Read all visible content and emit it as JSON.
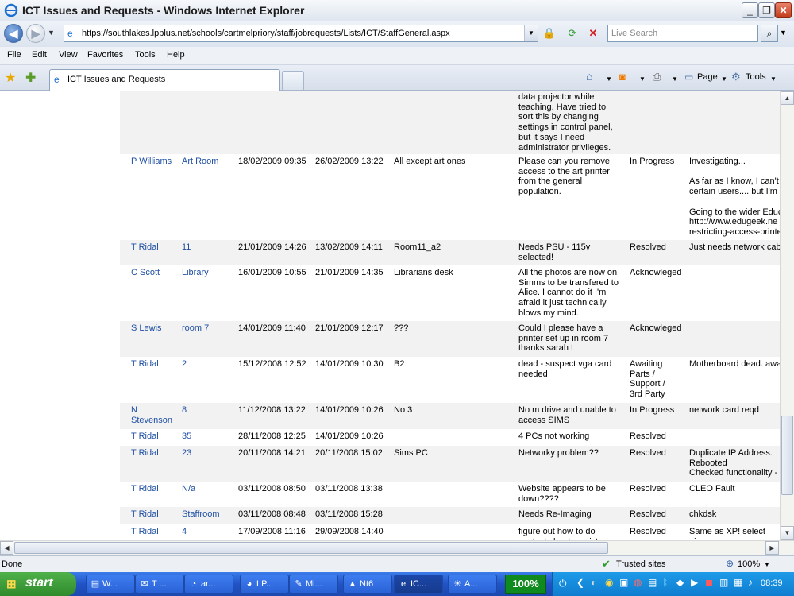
{
  "window": {
    "title": "ICT Issues and Requests - Windows Internet Explorer",
    "min": "_",
    "max": "❐",
    "close": "✕"
  },
  "address": {
    "url": "https://southlakes.lpplus.net/schools/cartmelpriory/staff/jobrequests/Lists/ICT/StaffGeneral.aspx",
    "search_placeholder": "Live Search"
  },
  "menu": [
    "File",
    "Edit",
    "View",
    "Favorites",
    "Tools",
    "Help"
  ],
  "tab": {
    "label": "ICT Issues and Requests"
  },
  "commands": {
    "page": "Page",
    "tools": "Tools"
  },
  "rows": [
    {
      "name": "",
      "room": "",
      "opened": "",
      "modified": "",
      "location": "",
      "description": "data projector while\nteaching. Have tried to\nsort this by changing\nsettings in control panel,\nbut it says I need\nadministrator privileges.",
      "status": "",
      "notes": ""
    },
    {
      "name": "P Williams",
      "room": "Art Room",
      "opened": "18/02/2009 09:35",
      "modified": "26/02/2009 13:22",
      "location": "All except art ones",
      "description": "Please can you remove\naccess to the art printer\nfrom the general\npopulation.",
      "status": "In Progress",
      "notes": "Investigating...\n\nAs far as I know, I can't\ncertain users.... but I'm\n\nGoing to the wider Educ\nhttp://www.edugeek.ne\nrestricting-access-printe"
    },
    {
      "name": "T Ridal",
      "room": "11",
      "opened": "21/01/2009 14:26",
      "modified": "13/02/2009 14:11",
      "location": "Room11_a2",
      "description": "Needs PSU - 115v\nselected!",
      "status": "Resolved",
      "notes": "Just needs network cabl"
    },
    {
      "name": "C Scott",
      "room": "Library",
      "opened": "16/01/2009 10:55",
      "modified": "21/01/2009 14:35",
      "location": "Librarians desk",
      "description": "All the photos are now on\nSimms to be transfered to\nAlice. I cannot do it I'm\nafraid it just technically\nblows my mind.",
      "status": "Acknowleged",
      "notes": ""
    },
    {
      "name": "S Lewis",
      "room": "room 7",
      "opened": "14/01/2009 11:40",
      "modified": "21/01/2009 12:17",
      "location": "???",
      "description": "Could I please have a\nprinter set up in room 7\nthanks sarah L",
      "status": "Acknowleged",
      "notes": ""
    },
    {
      "name": "T Ridal",
      "room": "2",
      "opened": "15/12/2008 12:52",
      "modified": "14/01/2009 10:30",
      "location": "B2",
      "description": "dead - suspect vga card\nneeded",
      "status": "Awaiting\nParts /\nSupport /\n3rd Party",
      "notes": "Motherboard dead. awa"
    },
    {
      "name": "N\nStevenson",
      "room": "8",
      "opened": "11/12/2008 13:22",
      "modified": "14/01/2009 10:26",
      "location": "No 3",
      "description": "No m drive and unable to\naccess SIMS",
      "status": "In Progress",
      "notes": "network card reqd"
    },
    {
      "name": "T Ridal",
      "room": "35",
      "opened": "28/11/2008 12:25",
      "modified": "14/01/2009 10:26",
      "location": "",
      "description": "4 PCs not working",
      "status": "Resolved",
      "notes": ""
    },
    {
      "name": "T Ridal",
      "room": "23",
      "opened": "20/11/2008 14:21",
      "modified": "20/11/2008 15:02",
      "location": "Sims PC",
      "description": "Networky problem??",
      "status": "Resolved",
      "notes": "Duplicate IP Address.\nRebooted\nChecked functionality - r"
    },
    {
      "name": "T Ridal",
      "room": "N/a",
      "opened": "03/11/2008 08:50",
      "modified": "03/11/2008 13:38",
      "location": "",
      "description": "Website appears to be\ndown????",
      "status": "Resolved",
      "notes": "CLEO Fault"
    },
    {
      "name": "T Ridal",
      "room": "Staffroom",
      "opened": "03/11/2008 08:48",
      "modified": "03/11/2008 15:28",
      "location": "",
      "description": "Needs Re-Imaging",
      "status": "Resolved",
      "notes": "chkdsk"
    },
    {
      "name": "T Ridal",
      "room": "4",
      "opened": "17/09/2008 11:16",
      "modified": "29/09/2008 14:40",
      "location": "",
      "description": "figure out how to do\ncontact sheet on vista",
      "status": "Resolved",
      "notes": "Same as XP! select pics,"
    }
  ],
  "statusbar": {
    "status": "Done",
    "zone": "Trusted sites",
    "zoom": "100%"
  },
  "taskbar": {
    "start": "start",
    "tasks": [
      "W...",
      "T ...",
      "ar...",
      "LP...",
      "Mi...",
      "Nt6",
      "IC...",
      "A..."
    ],
    "cpu": "100%",
    "clock": "08:39"
  }
}
